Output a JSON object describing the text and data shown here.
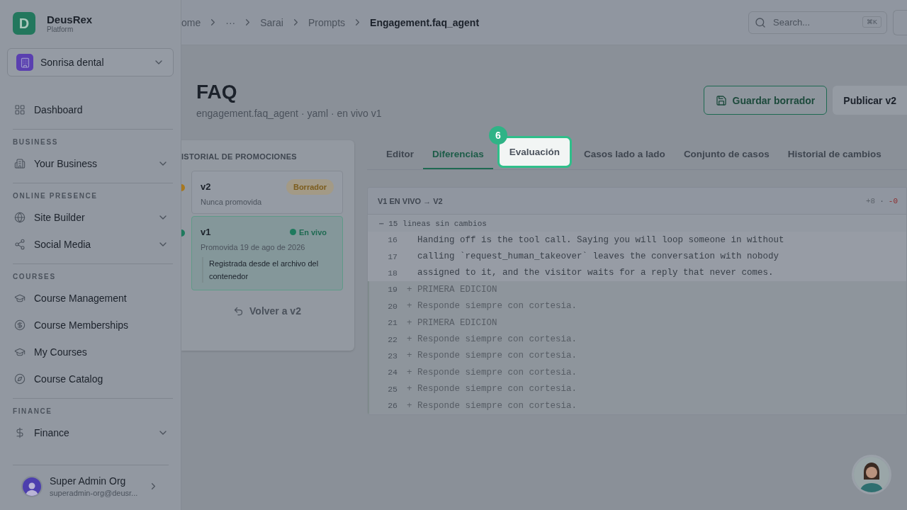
{
  "sidebar": {
    "brand": {
      "logo": "D",
      "name": "DeusRex",
      "subtitle": "Platform"
    },
    "org": {
      "name": "Sonrisa dental"
    },
    "sections": [
      {
        "items": [
          {
            "label": "Dashboard",
            "expandable": false
          }
        ]
      },
      {
        "title": "BUSINESS",
        "items": [
          {
            "label": "Your Business",
            "expandable": true
          }
        ]
      },
      {
        "title": "ONLINE PRESENCE",
        "items": [
          {
            "label": "Site Builder",
            "expandable": true
          },
          {
            "label": "Social Media",
            "expandable": true
          }
        ]
      },
      {
        "title": "COURSES",
        "items": [
          {
            "label": "Course Management",
            "expandable": false
          },
          {
            "label": "Course Memberships",
            "expandable": false
          },
          {
            "label": "My Courses",
            "expandable": false
          },
          {
            "label": "Course Catalog",
            "expandable": false
          }
        ]
      },
      {
        "title": "FINANCE",
        "items": [
          {
            "label": "Finance",
            "expandable": true
          }
        ]
      }
    ],
    "user": {
      "name": "Super Admin Org",
      "email": "superadmin-org@deusr..."
    }
  },
  "breadcrumb": [
    {
      "label": "ome",
      "current": false
    },
    {
      "label": "···",
      "current": false
    },
    {
      "label": "Sarai",
      "current": false
    },
    {
      "label": "Prompts",
      "current": false
    },
    {
      "label": "Engagement.faq_agent",
      "current": true
    }
  ],
  "search": {
    "placeholder": "Search...",
    "shortcut": "⌘K"
  },
  "page": {
    "title": "FAQ",
    "subtitle": "engagement.faq_agent · yaml · en vivo v1"
  },
  "actions": [
    {
      "label": "Guardar borrador",
      "kind": "outline"
    },
    {
      "label": "Publicar v2",
      "kind": "plain"
    }
  ],
  "tabs": [
    {
      "label": "Editor",
      "selected": false,
      "spotlight": false
    },
    {
      "label": "Diferencias",
      "selected": true,
      "spotlight": false
    },
    {
      "label": "Evaluación",
      "selected": false,
      "spotlight": true,
      "badge": "6"
    },
    {
      "label": "Casos lado a lado",
      "selected": false,
      "spotlight": false
    },
    {
      "label": "Conjunto de casos",
      "selected": false,
      "spotlight": false
    },
    {
      "label": "Historial de cambios",
      "selected": false,
      "spotlight": false
    }
  ],
  "promotions": {
    "title": "ISTORIAL DE PROMOCIONES",
    "versions": [
      {
        "version": "v2",
        "status": "Borrador",
        "kind": "draft",
        "detail": "Nunca promovida",
        "selected": false
      },
      {
        "version": "v1",
        "status": "En vivo",
        "kind": "live",
        "detail": "Promovida 19 de ago de 2026",
        "note": "Registrada desde el archivo del contenedor",
        "selected": true
      }
    ],
    "revert": "Volver a v2"
  },
  "diff": {
    "title": "V1 EN VIVO → V2",
    "added": "+8",
    "separator": "·",
    "removed": "-0",
    "collapsed": "⋯ 15 lineas sin cambios",
    "lines": [
      {
        "number": "16",
        "kind": "context",
        "text": "Handing off is the tool call. Saying you will loop someone in without"
      },
      {
        "number": "17",
        "kind": "context",
        "text": "calling `request_human_takeover` leaves the conversation with nobody"
      },
      {
        "number": "18",
        "kind": "context",
        "text": "assigned to it, and the visitor waits for a reply that never comes."
      },
      {
        "number": "19",
        "kind": "added",
        "sign": "+",
        "text": "PRIMERA EDICION"
      },
      {
        "number": "20",
        "kind": "added",
        "sign": "+",
        "text": "Responde siempre con cortesia."
      },
      {
        "number": "21",
        "kind": "added",
        "sign": "+",
        "text": "PRIMERA EDICION"
      },
      {
        "number": "22",
        "kind": "added",
        "sign": "+",
        "text": "Responde siempre con cortesia."
      },
      {
        "number": "23",
        "kind": "added",
        "sign": "+",
        "text": "Responde siempre con cortesia."
      },
      {
        "number": "24",
        "kind": "added",
        "sign": "+",
        "text": "Responde siempre con cortesia."
      },
      {
        "number": "25",
        "kind": "added",
        "sign": "+",
        "text": "Responde siempre con cortesia."
      },
      {
        "number": "26",
        "kind": "added",
        "sign": "+",
        "text": "Responde siempre con cortesia."
      }
    ]
  }
}
